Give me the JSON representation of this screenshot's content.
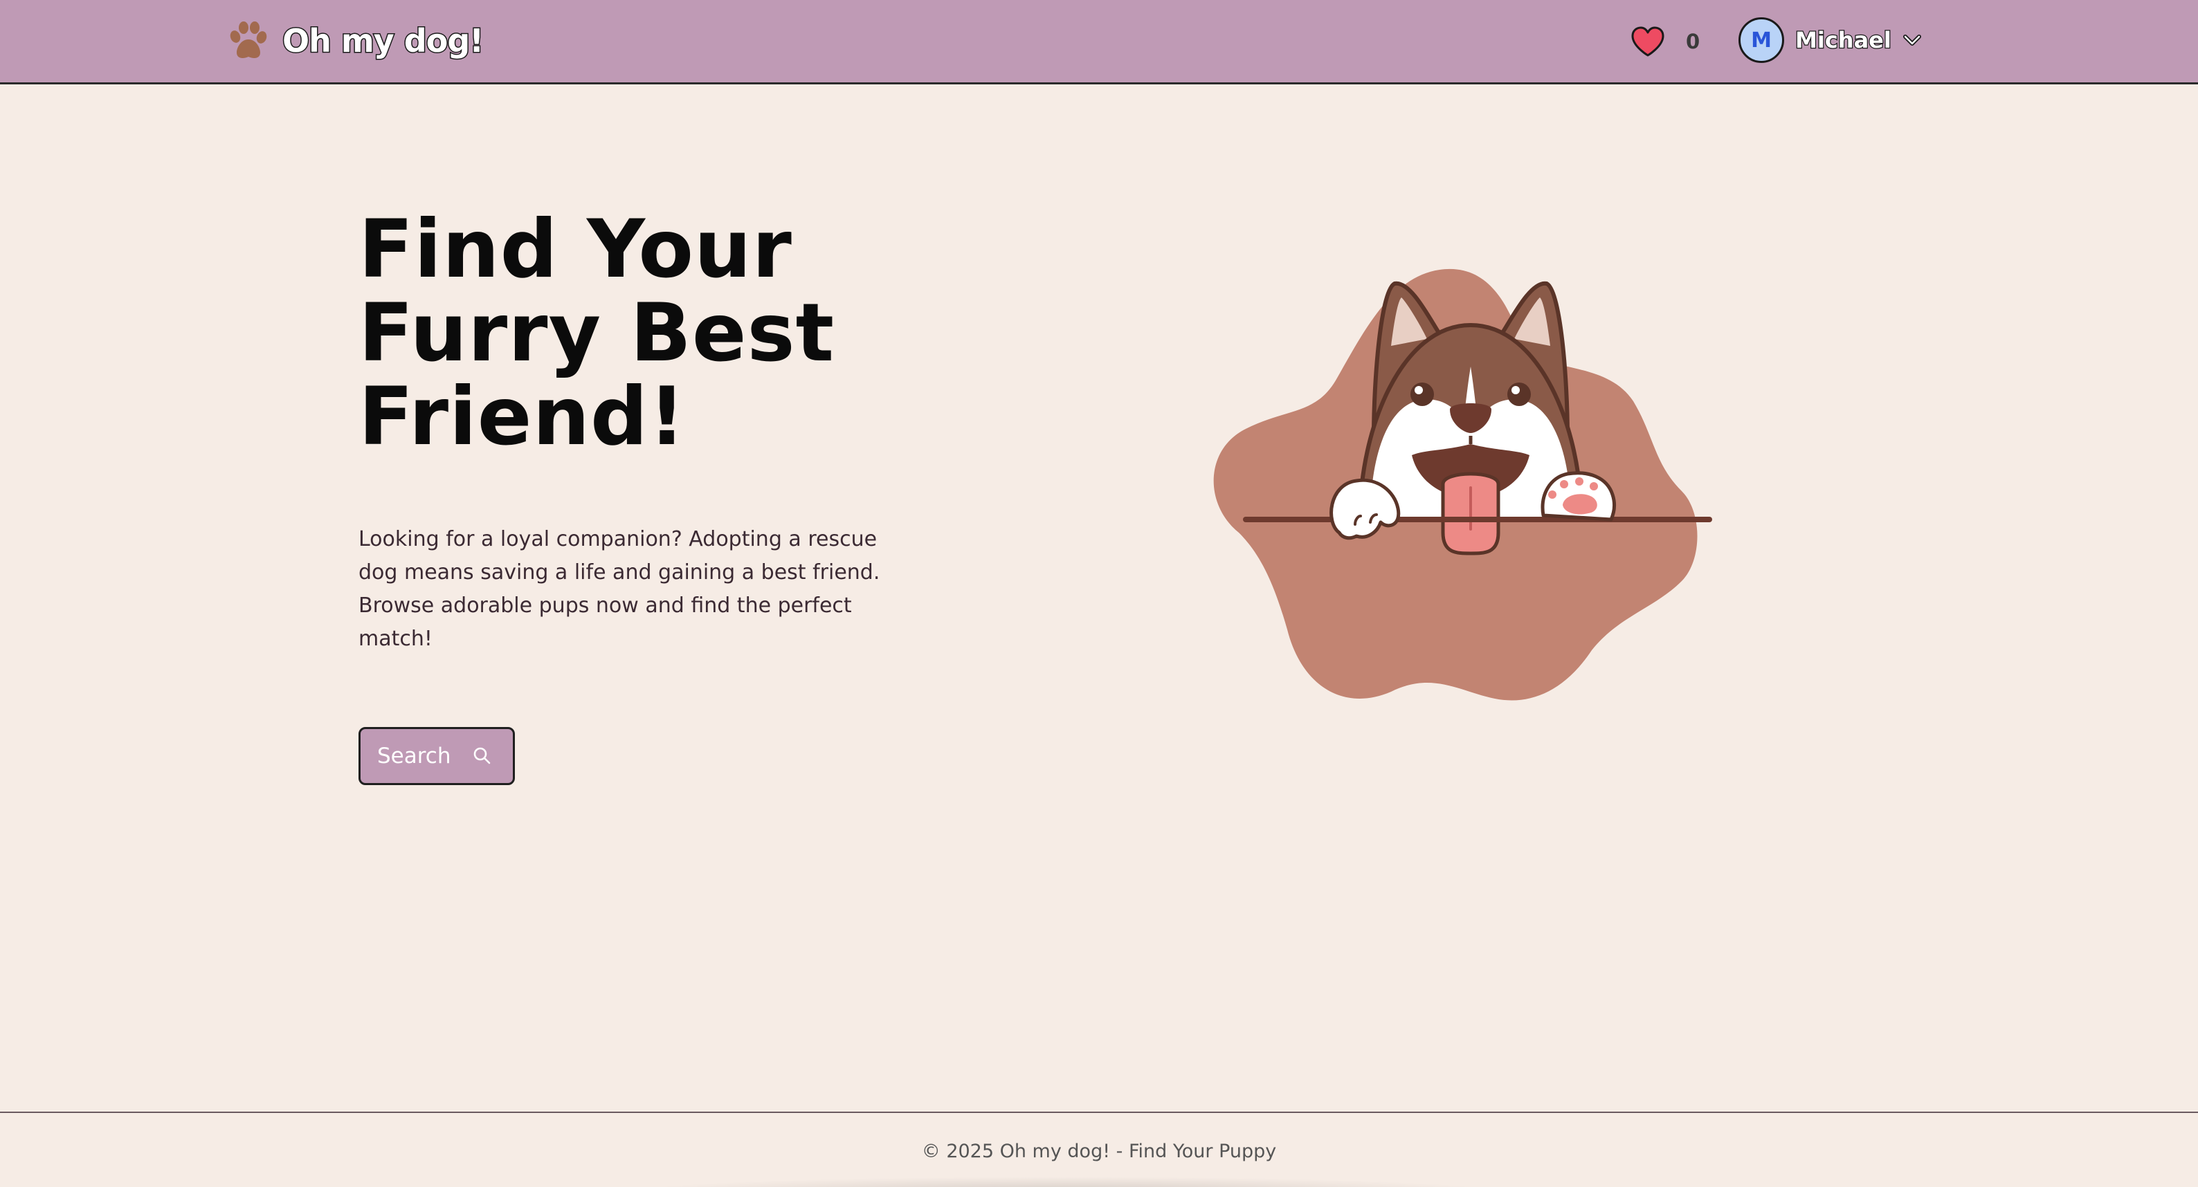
{
  "header": {
    "brand_name": "Oh my dog!",
    "brand_icon": "paw-icon",
    "favorites_icon": "heart-icon",
    "favorites_count": "0",
    "user": {
      "avatar_initial": "M",
      "name": "Michael",
      "menu_icon": "chevron-down-icon"
    }
  },
  "hero": {
    "title_lines": [
      "Find Your",
      "Furry Best",
      "Friend!"
    ],
    "description": "Looking for a loyal companion? Adopting a rescue dog means saving a life and gaining a best friend. Browse adorable pups now and find the perfect match!",
    "search_button": {
      "label": "Search",
      "icon": "search-icon"
    },
    "illustration": "husky-puppy-peeking-illustration"
  },
  "footer": {
    "text": "© 2025 Oh my dog! - Find Your Puppy"
  },
  "colors": {
    "header_bg": "#bf9ab5",
    "page_bg": "#f6ece5",
    "accent_brown": "#a26a4e",
    "blob": "#c28472",
    "heart": "#ee4b62",
    "avatar_bg": "#b9d3f7"
  }
}
